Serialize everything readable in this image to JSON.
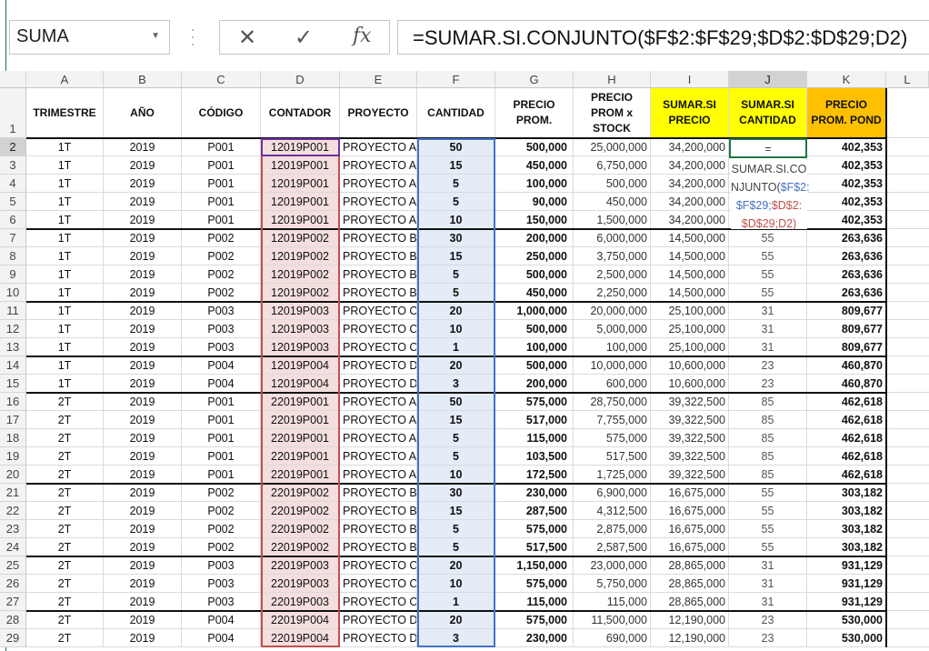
{
  "name_box": {
    "value": "SUMA"
  },
  "formula_bar": {
    "cancel_icon": "✕",
    "enter_icon": "✓",
    "fx_icon": "fx",
    "formula": "=SUMAR.SI.CONJUNTO($F$2:$F$29;$D$2:$D$29;D2)"
  },
  "column_headers": [
    "A",
    "B",
    "C",
    "D",
    "E",
    "F",
    "G",
    "H",
    "I",
    "J",
    "K",
    "L"
  ],
  "header_row": [
    "TRIMESTRE",
    "AÑO",
    "CÓDIGO",
    "CONTADOR",
    "PROYECTO",
    "CANTIDAD",
    "PRECIO PROM.",
    "PRECIO PROM x STOCK",
    "SUMAR.SI PRECIO",
    "SUMAR.SI CANTIDAD",
    "PRECIO PROM. POND"
  ],
  "editing": {
    "line1": "=",
    "line2": "SUMAR.SI.CO",
    "line3_a": "NJUNTO(",
    "line3_b": "$F$2:",
    "line4": "$F$29;",
    "line4_b": "$D$2:",
    "line5": "$D$29;D2)"
  },
  "rows": [
    [
      "1T",
      "2019",
      "P001",
      "12019P001",
      "PROYECTO A",
      "50",
      "500,000",
      "25,000,000",
      "34,200,000",
      "",
      "402,353"
    ],
    [
      "1T",
      "2019",
      "P001",
      "12019P001",
      "PROYECTO A",
      "15",
      "450,000",
      "6,750,000",
      "34,200,000",
      "",
      "402,353"
    ],
    [
      "1T",
      "2019",
      "P001",
      "12019P001",
      "PROYECTO A",
      "5",
      "100,000",
      "500,000",
      "34,200,000",
      "",
      "402,353"
    ],
    [
      "1T",
      "2019",
      "P001",
      "12019P001",
      "PROYECTO A",
      "5",
      "90,000",
      "450,000",
      "34,200,000",
      "",
      "402,353"
    ],
    [
      "1T",
      "2019",
      "P001",
      "12019P001",
      "PROYECTO A",
      "10",
      "150,000",
      "1,500,000",
      "34,200,000",
      "",
      "402,353"
    ],
    [
      "1T",
      "2019",
      "P002",
      "12019P002",
      "PROYECTO B",
      "30",
      "200,000",
      "6,000,000",
      "14,500,000",
      "55",
      "263,636"
    ],
    [
      "1T",
      "2019",
      "P002",
      "12019P002",
      "PROYECTO B",
      "15",
      "250,000",
      "3,750,000",
      "14,500,000",
      "55",
      "263,636"
    ],
    [
      "1T",
      "2019",
      "P002",
      "12019P002",
      "PROYECTO B",
      "5",
      "500,000",
      "2,500,000",
      "14,500,000",
      "55",
      "263,636"
    ],
    [
      "1T",
      "2019",
      "P002",
      "12019P002",
      "PROYECTO B",
      "5",
      "450,000",
      "2,250,000",
      "14,500,000",
      "55",
      "263,636"
    ],
    [
      "1T",
      "2019",
      "P003",
      "12019P003",
      "PROYECTO C",
      "20",
      "1,000,000",
      "20,000,000",
      "25,100,000",
      "31",
      "809,677"
    ],
    [
      "1T",
      "2019",
      "P003",
      "12019P003",
      "PROYECTO C",
      "10",
      "500,000",
      "5,000,000",
      "25,100,000",
      "31",
      "809,677"
    ],
    [
      "1T",
      "2019",
      "P003",
      "12019P003",
      "PROYECTO C",
      "1",
      "100,000",
      "100,000",
      "25,100,000",
      "31",
      "809,677"
    ],
    [
      "1T",
      "2019",
      "P004",
      "12019P004",
      "PROYECTO D",
      "20",
      "500,000",
      "10,000,000",
      "10,600,000",
      "23",
      "460,870"
    ],
    [
      "1T",
      "2019",
      "P004",
      "12019P004",
      "PROYECTO D",
      "3",
      "200,000",
      "600,000",
      "10,600,000",
      "23",
      "460,870"
    ],
    [
      "2T",
      "2019",
      "P001",
      "22019P001",
      "PROYECTO A",
      "50",
      "575,000",
      "28,750,000",
      "39,322,500",
      "85",
      "462,618"
    ],
    [
      "2T",
      "2019",
      "P001",
      "22019P001",
      "PROYECTO A",
      "15",
      "517,000",
      "7,755,000",
      "39,322,500",
      "85",
      "462,618"
    ],
    [
      "2T",
      "2019",
      "P001",
      "22019P001",
      "PROYECTO A",
      "5",
      "115,000",
      "575,000",
      "39,322,500",
      "85",
      "462,618"
    ],
    [
      "2T",
      "2019",
      "P001",
      "22019P001",
      "PROYECTO A",
      "5",
      "103,500",
      "517,500",
      "39,322,500",
      "85",
      "462,618"
    ],
    [
      "2T",
      "2019",
      "P001",
      "22019P001",
      "PROYECTO A",
      "10",
      "172,500",
      "1,725,000",
      "39,322,500",
      "85",
      "462,618"
    ],
    [
      "2T",
      "2019",
      "P002",
      "22019P002",
      "PROYECTO B",
      "30",
      "230,000",
      "6,900,000",
      "16,675,000",
      "55",
      "303,182"
    ],
    [
      "2T",
      "2019",
      "P002",
      "22019P002",
      "PROYECTO B",
      "15",
      "287,500",
      "4,312,500",
      "16,675,000",
      "55",
      "303,182"
    ],
    [
      "2T",
      "2019",
      "P002",
      "22019P002",
      "PROYECTO B",
      "5",
      "575,000",
      "2,875,000",
      "16,675,000",
      "55",
      "303,182"
    ],
    [
      "2T",
      "2019",
      "P002",
      "22019P002",
      "PROYECTO B",
      "5",
      "517,500",
      "2,587,500",
      "16,675,000",
      "55",
      "303,182"
    ],
    [
      "2T",
      "2019",
      "P003",
      "22019P003",
      "PROYECTO C",
      "20",
      "1,150,000",
      "23,000,000",
      "28,865,000",
      "31",
      "931,129"
    ],
    [
      "2T",
      "2019",
      "P003",
      "22019P003",
      "PROYECTO C",
      "10",
      "575,000",
      "5,750,000",
      "28,865,000",
      "31",
      "931,129"
    ],
    [
      "2T",
      "2019",
      "P003",
      "22019P003",
      "PROYECTO C",
      "1",
      "115,000",
      "115,000",
      "28,865,000",
      "31",
      "931,129"
    ],
    [
      "2T",
      "2019",
      "P004",
      "22019P004",
      "PROYECTO D",
      "20",
      "575,000",
      "11,500,000",
      "12,190,000",
      "23",
      "530,000"
    ],
    [
      "2T",
      "2019",
      "P004",
      "22019P004",
      "PROYECTO D",
      "3",
      "230,000",
      "690,000",
      "12,190,000",
      "23",
      "530,000"
    ]
  ],
  "colors": {
    "excel_green": "#217346",
    "yellow_header": "#ffff00",
    "orange_header": "#ffc000",
    "ref_blue": "#4472c4",
    "ref_red": "#c0504d",
    "ref_purple": "#7030a0"
  }
}
